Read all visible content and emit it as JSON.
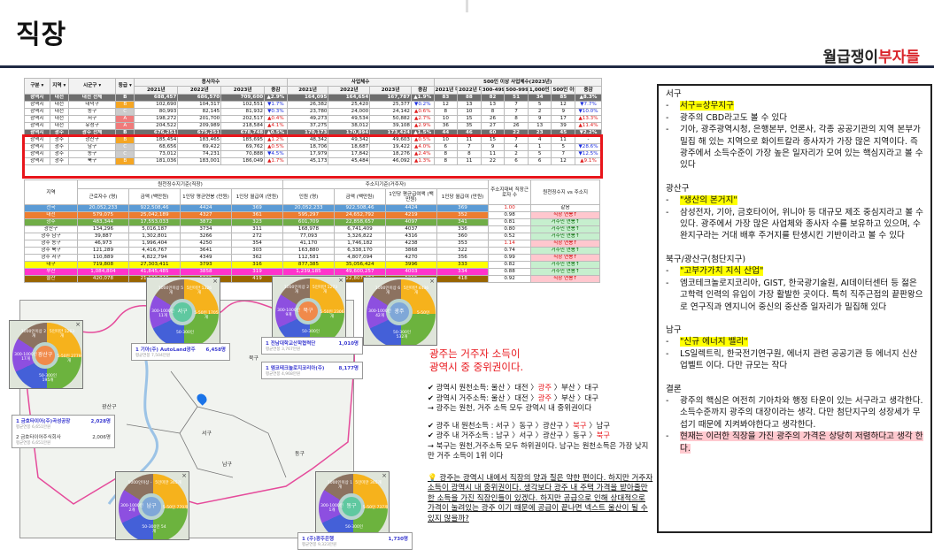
{
  "title": "직장",
  "logo": {
    "part1": "월급쟁이",
    "part2": "부자들"
  },
  "table1": {
    "group_headers": [
      "종사자수",
      "사업체수",
      "500인 이상 사업체수(2023년)"
    ],
    "headers": [
      "구분",
      "지역",
      "시군구",
      "등급",
      "2021년",
      "2022년",
      "2023년",
      "증감",
      "2021년",
      "2022년",
      "2023년",
      "증감",
      "2021년 대기",
      "2022년 대기",
      "300-499",
      "500-999",
      "1,000인 이상",
      "500인 이상",
      "증감"
    ],
    "rows": [
      {
        "total": true,
        "cells": [
          "광역시",
          "대전",
          "대전 전체",
          "B",
          "688,457",
          "686,570",
          "709,600",
          "▲2.9%",
          "164,095",
          "164,654",
          "167,787",
          "▲1.9%",
          "83",
          "88",
          "82",
          "51",
          "34",
          "85",
          "▲8.3%"
        ]
      },
      {
        "cells": [
          "광역시",
          "대전",
          "대덕구",
          "B",
          "102,690",
          "104,317",
          "102,551",
          "▼1.7%",
          "26,382",
          "25,420",
          "25,377",
          "▼0.2%",
          "12",
          "13",
          "13",
          "7",
          "5",
          "12",
          "▼7.7%"
        ]
      },
      {
        "cells": [
          "광역시",
          "대전",
          "동구",
          "C",
          "80,993",
          "82,145",
          "81,932",
          "▼0.3%",
          "23,780",
          "24,000",
          "24,142",
          "▲0.6%",
          "8",
          "10",
          "8",
          "7",
          "2",
          "9",
          "▼10.0%"
        ]
      },
      {
        "cells": [
          "광역시",
          "대전",
          "서구",
          "A",
          "198,272",
          "201,700",
          "202,517",
          "▲0.4%",
          "49,273",
          "49,534",
          "50,882",
          "▲2.7%",
          "10",
          "15",
          "26",
          "8",
          "9",
          "17",
          "▲13.3%"
        ]
      },
      {
        "cells": [
          "광역시",
          "대전",
          "유성구",
          "A",
          "204,522",
          "209,989",
          "218,584",
          "▲4.1%",
          "37,275",
          "38,012",
          "39,108",
          "▲2.9%",
          "36",
          "35",
          "27",
          "26",
          "13",
          "39",
          "▲11.4%"
        ]
      },
      {
        "total": true,
        "cells": [
          "광역시",
          "광주",
          "광주 전체",
          "B",
          "676,251",
          "675,251",
          "678,748",
          "▲0.5%",
          "170,173",
          "170,894",
          "173,424",
          "▲1.5%",
          "44",
          "46",
          "60",
          "22",
          "23",
          "45",
          "▼2.2%"
        ]
      },
      {
        "cells": [
          "광역시",
          "광주",
          "광산구",
          "B",
          "185,454",
          "183,465",
          "185,695",
          "▲1.2%",
          "48,342",
          "49,342",
          "49,603",
          "▲0.5%",
          "10",
          "11",
          "15",
          "7",
          "4",
          "11",
          "-"
        ]
      },
      {
        "cells": [
          "광역시",
          "광주",
          "남구",
          "C",
          "68,656",
          "69,422",
          "69,762",
          "▲0.5%",
          "18,706",
          "18,687",
          "19,422",
          "▲4.0%",
          "6",
          "7",
          "9",
          "4",
          "1",
          "5",
          "▼28.6%"
        ]
      },
      {
        "cells": [
          "광역시",
          "광주",
          "동구",
          "C",
          "73,012",
          "74,231",
          "70,888",
          "▼4.5%",
          "17,979",
          "17,842",
          "18,276",
          "▲2.4%",
          "8",
          "8",
          "11",
          "2",
          "5",
          "7",
          "▼12.5%"
        ]
      },
      {
        "cells": [
          "광역시",
          "광주",
          "북구",
          "B",
          "181,036",
          "183,001",
          "186,049",
          "▲1.7%",
          "45,173",
          "45,484",
          "46,092",
          "▲1.3%",
          "8",
          "11",
          "22",
          "6",
          "6",
          "12",
          "▲9.1%"
        ]
      }
    ]
  },
  "table2": {
    "group_headers": [
      "원천징수지기준(직장)",
      "주소지기준(거주자)"
    ],
    "headers": [
      "지역",
      "근로자수 (명)",
      "금액 (백만원)",
      "1인당 평균연봉 (만원)",
      "1인당 월급여 (만원)",
      "인원 (명)",
      "금액 (백만원)",
      "1인당 평균급여액 (백만원)",
      "1인당 월급여 (만원)",
      "주소지대비 직장근로자 수",
      "원천징수지 vs 주소지"
    ],
    "rows": [
      {
        "color": "#5b9bd5",
        "cells": [
          "전국",
          "20,052,233",
          "922,508,46",
          "4424",
          "369",
          "20,052,233",
          "922,508,46",
          "4424",
          "369",
          "1.00",
          "같음"
        ]
      },
      {
        "color": "#ed7d31",
        "cells": [
          "대전",
          "579,075",
          "25,042,189",
          "4327",
          "361",
          "595,297",
          "24,652,792",
          "4219",
          "352",
          "0.98",
          "직장 연봉↑"
        ]
      },
      {
        "color": "#70ad47",
        "cells": [
          "광주",
          "483,344",
          "17,553,033",
          "3872",
          "323",
          "601,709",
          "22,858,657",
          "4097",
          "341",
          "0.81",
          "거주민 연봉↑"
        ]
      },
      {
        "color": "",
        "cells": [
          "광산구",
          "134,296",
          "5,016,187",
          "3734",
          "311",
          "168,978",
          "6,741,409",
          "4037",
          "336",
          "0.80",
          "거주민 연봉↑"
        ]
      },
      {
        "color": "",
        "cells": [
          "광주 남구",
          "39,887",
          "1,302,801",
          "3266",
          "272",
          "77,093",
          "3,326,822",
          "4316",
          "360",
          "0.52",
          "거주민 연봉↑"
        ]
      },
      {
        "color": "",
        "cells": [
          "광주 동구",
          "46,973",
          "1,996,404",
          "4250",
          "354",
          "41,170",
          "1,746,182",
          "4238",
          "353",
          "1.14",
          "직장 연봉↑"
        ]
      },
      {
        "color": "",
        "cells": [
          "광주 북구",
          "121,289",
          "4,416,767",
          "3641",
          "303",
          "163,880",
          "6,338,170",
          "3868",
          "322",
          "0.74",
          "거주민 연봉↑"
        ]
      },
      {
        "color": "",
        "cells": [
          "광주 서구",
          "110,889",
          "4,822,794",
          "4349",
          "362",
          "112,581",
          "4,807,094",
          "4270",
          "356",
          "0.99",
          "직장 연봉↑"
        ]
      },
      {
        "color": "#ffff00",
        "cells": [
          "대구",
          "719,808",
          "27,303,411",
          "3793",
          "316",
          "877,385",
          "35,056,424",
          "3996",
          "333",
          "0.82",
          "거주민 연봉↑"
        ]
      },
      {
        "color": "#ff33cc",
        "cells": [
          "부산",
          "1,084,804",
          "41,845,485",
          "3858",
          "319",
          "1,239,185",
          "49,600,257",
          "4003",
          "334",
          "0.88",
          "거주민 연봉↑"
        ]
      },
      {
        "color": "#996600",
        "cells": [
          "울산",
          "420,078",
          "21,100,840",
          "5025",
          "419",
          "454,761",
          "22,807,474",
          "5015",
          "418",
          "0.92",
          "직장 연봉↑"
        ]
      }
    ]
  },
  "map": {
    "districts": [
      "광산구",
      "북구",
      "서구",
      "남구",
      "동구"
    ],
    "pies": [
      {
        "name": "광산구",
        "segments": [
          "5인미만 1263개",
          "5-50인 2779개",
          "50-300인 195개",
          "300-1000인 17개",
          "1000인이상 2개"
        ]
      },
      {
        "name": "서구",
        "segments": [
          "5인미만 1326개",
          "5-50인 1705개",
          "50-300인",
          "300-1000인 11개",
          "1000인이상 5개"
        ]
      },
      {
        "name": "북구",
        "segments": [
          "5인미만 1273개",
          "5-50인 2306개",
          "50-300인",
          "300-1000인 9개",
          "1000인이상 2개"
        ]
      },
      {
        "name": "광주",
        "segments": [
          "5인미만 4436개",
          "5-50인",
          "50-300인 532개",
          "300-1000인 42개",
          "1000인이상 6개"
        ]
      },
      {
        "name": "남구",
        "segments": [
          "5인미만 365개",
          "5-50인 770개",
          "50-300인 54개",
          "300-1000인 2개",
          "1000인이상 -"
        ]
      },
      {
        "name": "동구",
        "segments": [
          "5인미만 365개",
          "5-50인 737개",
          "50-300인",
          "300-1000인 1개",
          "1000인이상 1개"
        ]
      }
    ],
    "companies": [
      {
        "name": "1 기아(주) AutoLand광주",
        "count": "6,458명",
        "salary": "평균연봉 7,504만원"
      },
      {
        "name": "1 전남대학교산학협력단",
        "count": "1,010명",
        "salary": "평균연봉 3,767만원"
      },
      {
        "name": "1 엠코테크놀로지코리아(주)",
        "count": "8,177명",
        "salary": "평균연봉 4,968만원"
      },
      {
        "name": "1 금호타이어(주)곡성공장",
        "count": "2,028명",
        "salary": "평균연봉 6,651만원"
      },
      {
        "name": "2 금호타이어주식회사",
        "count": "2,006명",
        "salary": "평균연봉 6,651만원"
      },
      {
        "name": "1 (주)광주은행",
        "count": "1,730명",
        "salary": "평균연봉 9,323만원"
      }
    ]
  },
  "middle": {
    "headline1": "광주는 거주자 소득이",
    "headline2": "광역시 중 중위권이다.",
    "l1a": "✔ 광역시 원천소득: 울산 〉대전 〉",
    "l1b": "광주",
    "l1c": " 〉부산 〉대구",
    "l2a": "✔ 광역시 거주소득: 울산 〉대전 〉",
    "l2b": "광주",
    "l2c": " 〉부산 〉대구",
    "l3": "→ 광주는 원천, 거주 소득 모두 광역시 내 중위권이다",
    "l4a": "✔ 광주 내 원천소득 : 서구 〉동구 〉광산구 〉",
    "l4b": "북구",
    "l4c": " 〉남구",
    "l5a": "✔ 광주 내 거주소득 : 남구 〉서구 〉광산구 〉동구 〉",
    "l5b": "북구",
    "l6": "→ 북구는 원천,거주소득 모두 하위권이다. 남구는 원천소득은 가장 낮지만 거주 소득이 1위 이다",
    "insight": "💡 광주는 광역시 내에서 직장의 양과 질은 약한 편이다. 하지만 거주자 소득이 광역시 내 중위권이다. 생각보다 광주 내 주택 가격을 받아줄만한 소득을 가진 직장인들이 있겠다. 하지만 공급으로 인해 상대적으로 가격이 눌려있는 광주 이기 때문에 공급이 끝나면 넥스트 울산이 될 수 있지 않을까?"
  },
  "right": {
    "s1": {
      "title": "서구",
      "hl": "서구=상무지구",
      "b1": "광주의 CBD라고도 볼 수 있다",
      "b2": "기아, 광주광역시청, 은행본부, 언론사, 각종 공공기관의 지역 본부가 밀집 해 있는 지역으로 화이트칼라 종사자가 가장 많은 지역이다. 즉 광주에서 소득수준이 가장 높은 일자리가 모여 있는 핵심지라고 볼 수 있다"
    },
    "s2": {
      "title": "광산구",
      "hl": "\"생산의 본거지\"",
      "b1": "삼성전자, 기아, 금호타이어, 위니아 등 대규모 제조 중심지라고 볼 수 있다. 광주에서 가장 많은 사업체와 종사자 수를 보유하고 있으며, 수완지구라는 거대 배후 주거지를 탄생시킨 기반이라고 볼 수 있다"
    },
    "s3": {
      "title": "북구/광산구(첨단지구)",
      "hl": "\"고부가가치 지식 산업\"",
      "b1": "엠코테크놀로지코리아, GIST, 한국광기술원, AI데이터센터 등 젊은 고학력 인력의 유입이 가장 활발한 곳이다. 특히 직주근접의 끝판왕으로 연구직과 엔지니어 중신의 중산층 일자리가 밀집해 있다"
    },
    "s4": {
      "title": "남구",
      "hl": "\"신규 에너지 밸리\"",
      "b1": "LS일렉트릭, 한국전기연구원, 에너지 관련 공공기관 등 에너지 신산업벨트 이다. 다만 규모는 작다"
    },
    "s5": {
      "title": "결론",
      "b1": "광주의 핵심은 여전히 기아차와 행정 타운이 있는 서구라고 생각한다. 소득수준까지 광주의 대장이라는 생각. 다만 첨단지구의 성장세가 무섭기 때문에 지켜봐야한다고 생각한다.",
      "b2": "현재는 이러한 직장을 가진 광주의 가격은 상당히 저렴하다고 생각 한다."
    },
    "dash": "-"
  },
  "colors": {
    "up": "#e01b1b",
    "down": "#1b2ee0",
    "highlight": "#ffff00",
    "pink": "#ffc9cf",
    "redbox": "#e8151b"
  }
}
